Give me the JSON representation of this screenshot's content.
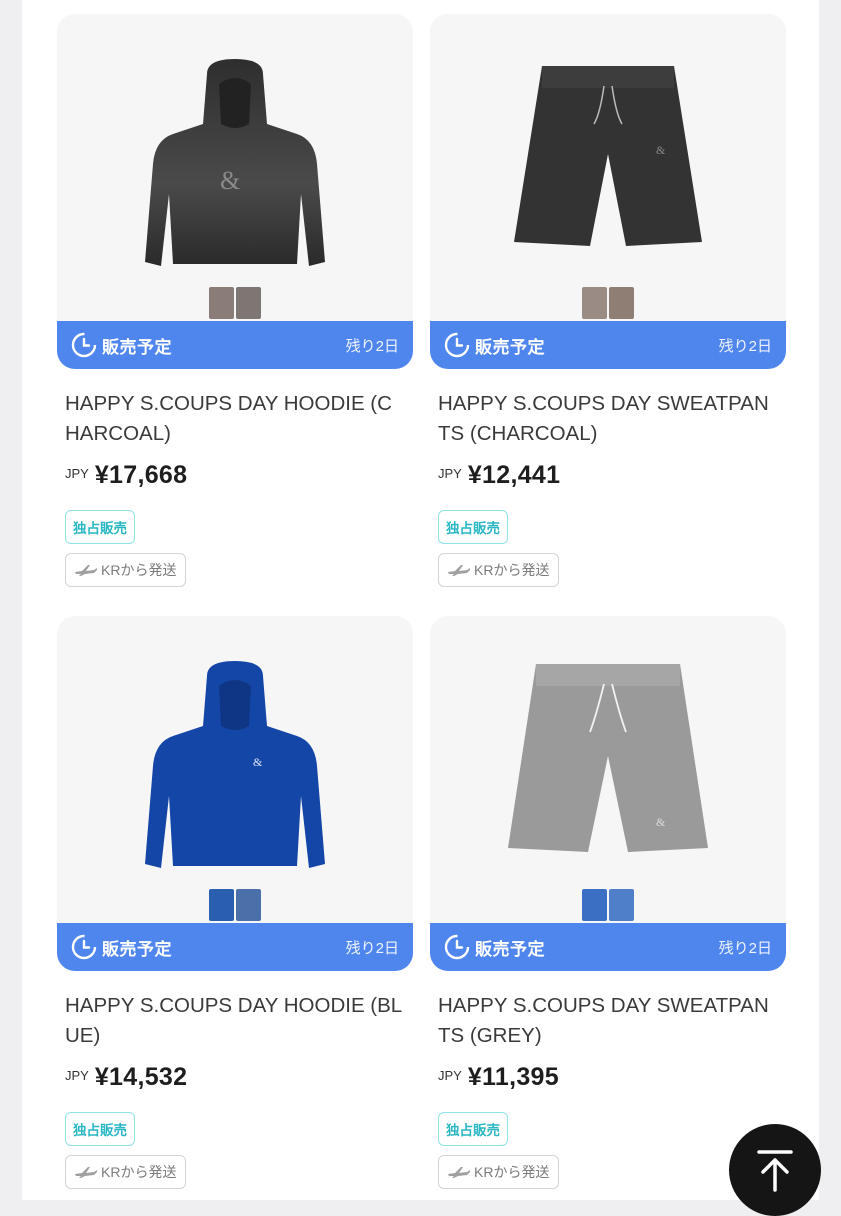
{
  "products": [
    {
      "title": "HAPPY S.COUPS DAY HOODIE (CHARCOAL)",
      "currency": "JPY",
      "price": "¥17,668",
      "sale_status": "販売予定",
      "remaining": "残り2日",
      "badge_exclusive": "独占販売",
      "badge_shipping": "KRから発送",
      "item_icon": "hoodie-icon",
      "item_color": "#3a3a3a"
    },
    {
      "title": "HAPPY S.COUPS DAY SWEATPANTS (CHARCOAL)",
      "currency": "JPY",
      "price": "¥12,441",
      "sale_status": "販売予定",
      "remaining": "残り2日",
      "badge_exclusive": "独占販売",
      "badge_shipping": "KRから発送",
      "item_icon": "shorts-icon",
      "item_color": "#3a3a3a"
    },
    {
      "title": "HAPPY S.COUPS DAY HOODIE (BLUE)",
      "currency": "JPY",
      "price": "¥14,532",
      "sale_status": "販売予定",
      "remaining": "残り2日",
      "badge_exclusive": "独占販売",
      "badge_shipping": "KRから発送",
      "item_icon": "hoodie-icon",
      "item_color": "#1446a8"
    },
    {
      "title": "HAPPY S.COUPS DAY SWEATPANTS (GREY)",
      "currency": "JPY",
      "price": "¥11,395",
      "sale_status": "販売予定",
      "remaining": "残り2日",
      "badge_exclusive": "独占販売",
      "badge_shipping": "KRから発送",
      "item_icon": "shorts-icon",
      "item_color": "#9a9a9a"
    }
  ],
  "accent_color": "#4f86ee",
  "scroll_top_icon": "arrow-up-icon"
}
